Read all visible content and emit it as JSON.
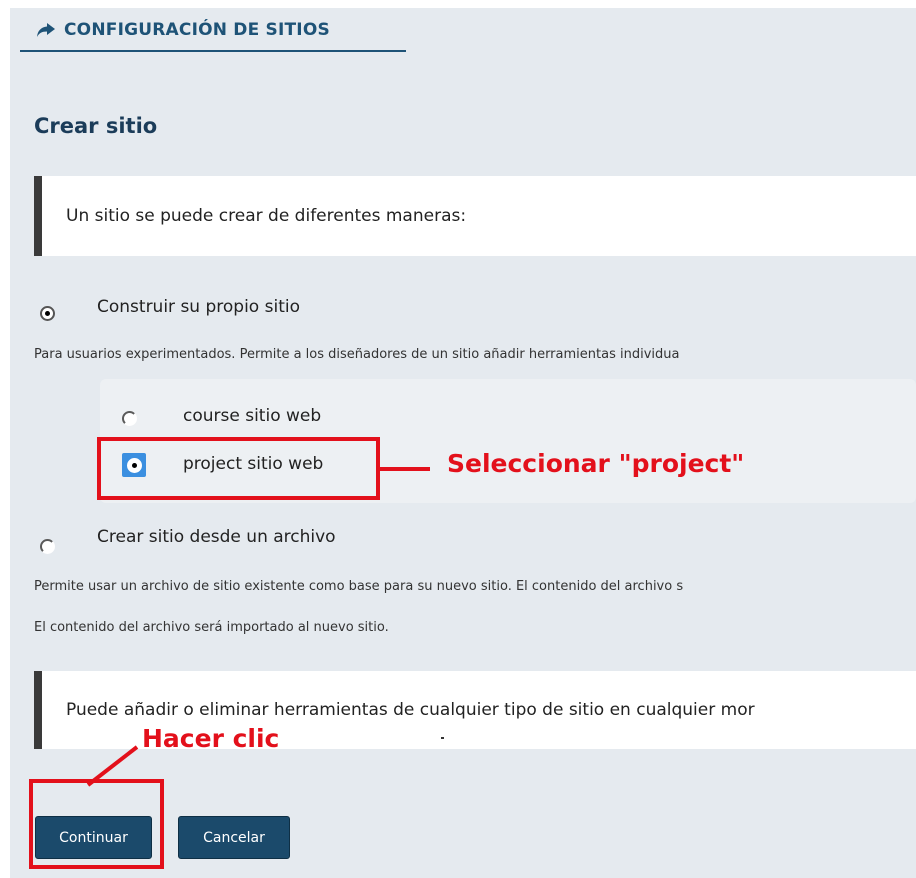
{
  "header": {
    "title": "CONFIGURACIÓN DE SITIOS",
    "icon": "share-arrow-icon"
  },
  "page_title": "Crear sitio",
  "intro_note": "Un sitio se puede crear de diferentes maneras:",
  "options": {
    "build_own": {
      "label": "Construir su propio sitio",
      "selected": true,
      "description": "Para usuarios experimentados. Permite a los diseñadores de un sitio añadir herramientas individua"
    },
    "site_types": [
      {
        "label": "course sitio web",
        "selected": false
      },
      {
        "label": "project sitio web",
        "selected": true
      }
    ],
    "from_archive": {
      "label": "Crear sitio desde un archivo",
      "selected": false,
      "description_line1": "Permite usar un archivo de sitio existente como base para su nuevo sitio. El contenido del archivo s",
      "description_line2": "El contenido del archivo será importado al nuevo sitio."
    }
  },
  "tools_note": "Puede añadir o eliminar herramientas de cualquier tipo de sitio en cualquier mor",
  "annotations": {
    "select_project": "Seleccionar \"project\"",
    "click_here": "Hacer clic",
    "color": "#e3101b"
  },
  "buttons": {
    "continue": "Continuar",
    "cancel": "Cancelar"
  },
  "colors": {
    "accent": "#1e5377",
    "button": "#1b4a6b",
    "panel_bg": "#e5eaef"
  }
}
